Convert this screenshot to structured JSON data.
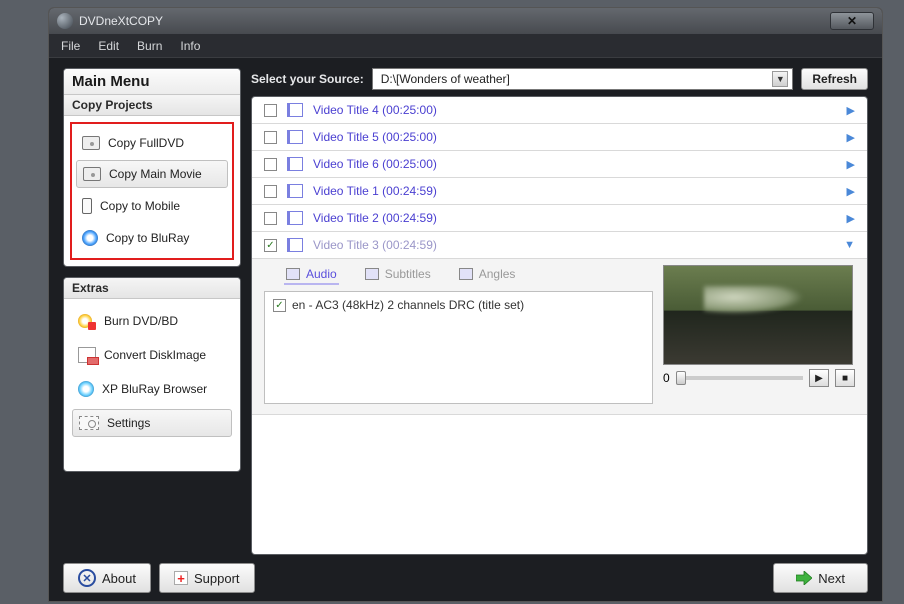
{
  "app": {
    "title": "DVDneXtCOPY"
  },
  "menu": {
    "file": "File",
    "edit": "Edit",
    "burn": "Burn",
    "info": "Info"
  },
  "sidebar": {
    "header": "Main Menu",
    "copyProjectsLabel": "Copy Projects",
    "copy": {
      "fulldvd": "Copy FullDVD",
      "mainmovie": "Copy Main Movie",
      "mobile": "Copy to Mobile",
      "bluray": "Copy to BluRay"
    },
    "extrasLabel": "Extras",
    "extras": {
      "burn": "Burn DVD/BD",
      "convert": "Convert DiskImage",
      "xpbluray": "XP BluRay Browser",
      "settings": "Settings"
    }
  },
  "source": {
    "label": "Select your Source:",
    "value": "D:\\[Wonders of weather]",
    "refresh": "Refresh"
  },
  "titles": [
    {
      "label": "Video Title  4 (00:25:00)",
      "checked": false,
      "expanded": false
    },
    {
      "label": "Video Title  5 (00:25:00)",
      "checked": false,
      "expanded": false
    },
    {
      "label": "Video Title  6 (00:25:00)",
      "checked": false,
      "expanded": false
    },
    {
      "label": "Video Title  1 (00:24:59)",
      "checked": false,
      "expanded": false
    },
    {
      "label": "Video Title  2 (00:24:59)",
      "checked": false,
      "expanded": false
    },
    {
      "label": "Video Title  3 (00:24:59)",
      "checked": true,
      "expanded": true
    }
  ],
  "detail": {
    "tabs": {
      "audio": "Audio",
      "subtitles": "Subtitles",
      "angles": "Angles"
    },
    "audioTrack": "en - AC3 (48kHz) 2 channels DRC (title set)",
    "slider": {
      "start": "0"
    }
  },
  "footer": {
    "about": "About",
    "support": "Support",
    "next": "Next"
  }
}
